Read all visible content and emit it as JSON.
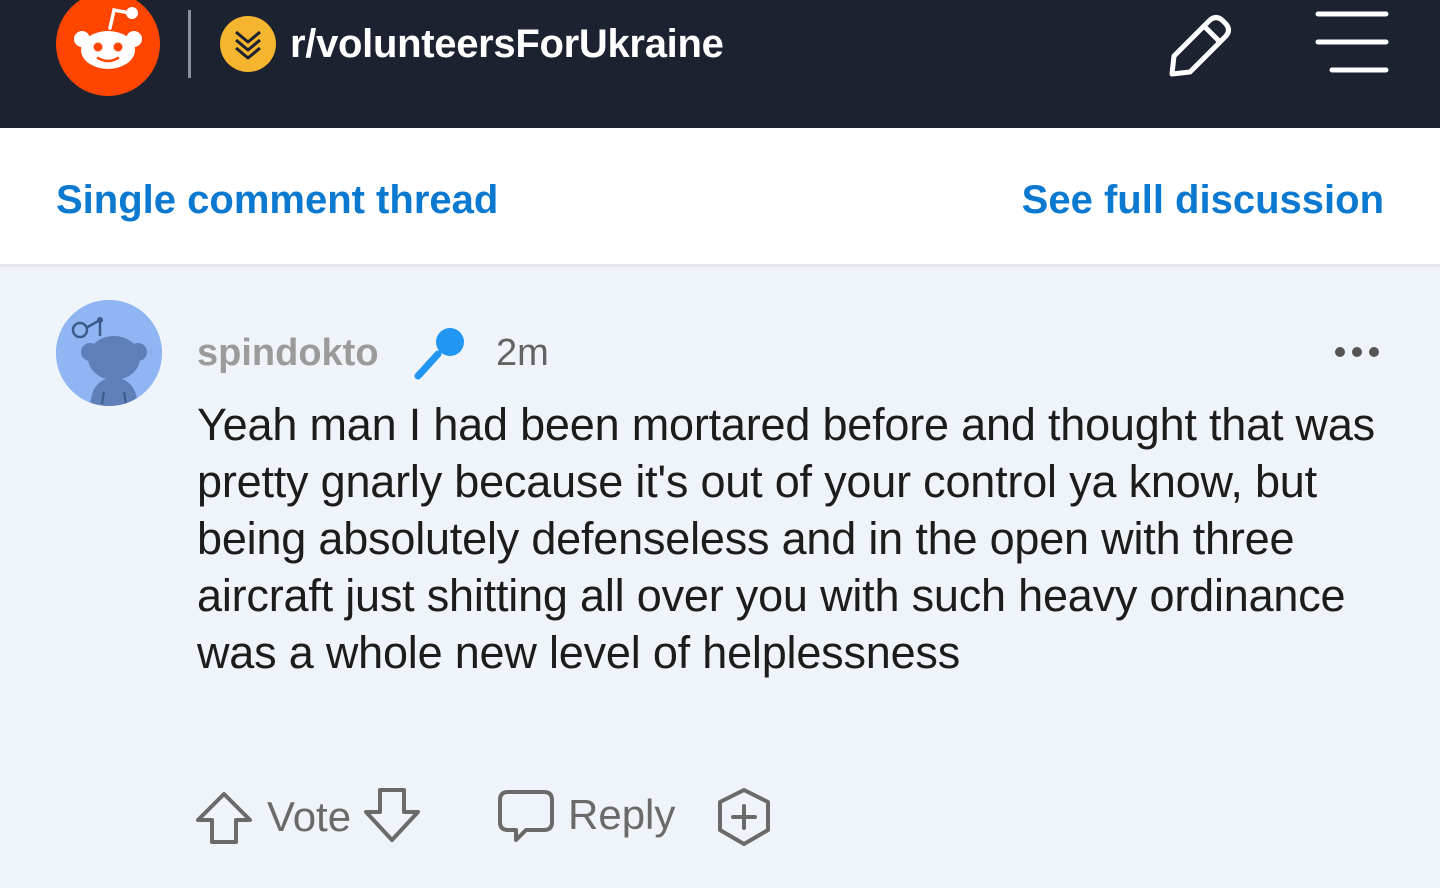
{
  "header": {
    "logo_icon": "reddit-snoo-logo",
    "subreddit_icon": "military-rank-chevron-icon",
    "subreddit_name": "r/volunteersForUkraine",
    "edit_icon": "pencil-icon",
    "menu_icon": "hamburger-menu-icon",
    "colors": {
      "background": "#1c2230",
      "logo": "#ff4500",
      "subreddit_icon": "#f6b52f"
    }
  },
  "thread_bar": {
    "left_link": "Single comment thread",
    "right_link": "See full discussion",
    "link_color": "#0b79d0"
  },
  "comment": {
    "author": "spindokto",
    "author_flair_icon": "microphone-icon",
    "timestamp": "2m",
    "more_icon": "more-options-icon",
    "body": "Yeah man I had been mortared before and thought that was pretty gnarly because it's out of your control ya know, but being absolutely defenseless and in the open with three aircraft just shitting all over you with such heavy ordinance was a whole new level of helplessness",
    "avatar_color": "#8fb6f2",
    "background": "#eef4f9"
  },
  "actions": {
    "upvote_icon": "upvote-arrow-icon",
    "vote_label": "Vote",
    "downvote_icon": "downvote-arrow-icon",
    "reply_icon": "speech-bubble-icon",
    "reply_label": "Reply",
    "award_icon": "award-plus-icon"
  }
}
